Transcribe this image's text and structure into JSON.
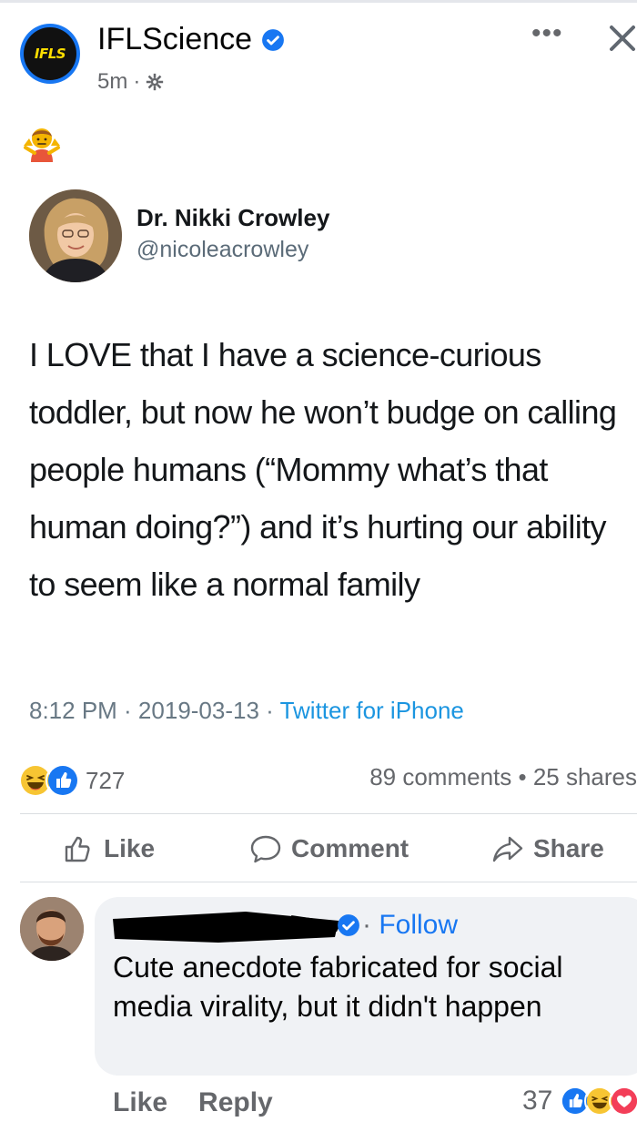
{
  "page": {
    "name": "IFLScience",
    "logo_text": "IFLS",
    "time": "5m",
    "meta_sep": "·",
    "accent": "#1877f2"
  },
  "header": {
    "more_label": "•••"
  },
  "tweet": {
    "author_name": "Dr. Nikki Crowley",
    "author_handle": "@nicoleacrowley",
    "text": "I LOVE that I have a science-curious toddler, but now he won’t budge on calling people humans (“Mommy what’s that human doing?”) and it’s hurting our ability to seem like a normal family",
    "time": "8:12 PM · 2019-03-13 · ",
    "source": "Twitter for iPhone"
  },
  "stats": {
    "reaction_count": "727",
    "comments_shares": "89 comments • 25 shares"
  },
  "actions": {
    "like": "Like",
    "comment": "Comment",
    "share": "Share"
  },
  "comment": {
    "follow_sep": "· ",
    "follow": "Follow",
    "text": "Cute anecdote fabricated for social media virality, but it didn't happen",
    "like": "Like",
    "reply": "Reply",
    "reaction_count": "37"
  }
}
